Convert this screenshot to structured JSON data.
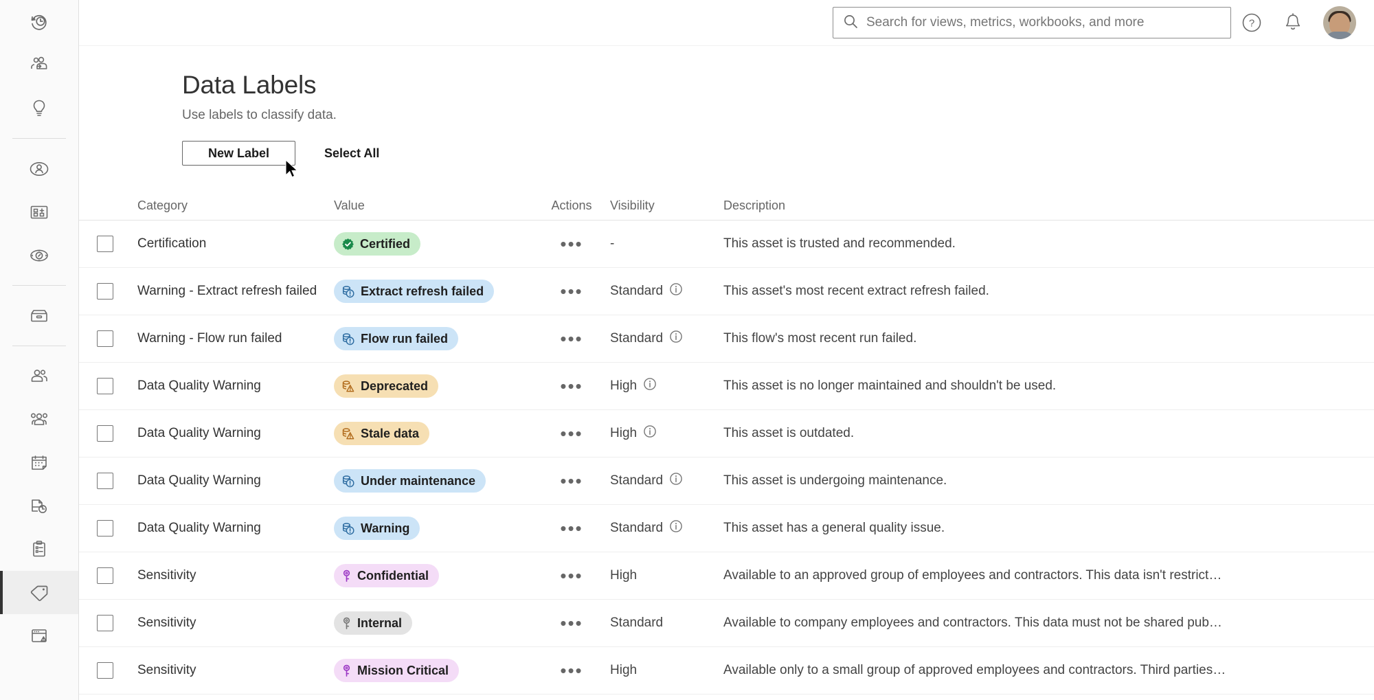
{
  "sidebar": {
    "groups": [
      {
        "items": [
          {
            "name": "recents-icon",
            "label": "Recents"
          },
          {
            "name": "shared-with-me-icon",
            "label": "Shared with Me"
          },
          {
            "name": "recommendations-icon",
            "label": "Recommendations"
          }
        ]
      },
      {
        "items": [
          {
            "name": "personal-space-icon",
            "label": "Personal Space"
          },
          {
            "name": "collections-icon",
            "label": "Collections"
          },
          {
            "name": "explore-icon",
            "label": "Explore"
          }
        ]
      },
      {
        "items": [
          {
            "name": "external-assets-icon",
            "label": "External Assets"
          }
        ]
      },
      {
        "items": [
          {
            "name": "users-icon",
            "label": "Users"
          },
          {
            "name": "groups-icon",
            "label": "Groups"
          },
          {
            "name": "schedules-icon",
            "label": "Schedules"
          },
          {
            "name": "tasks-icon",
            "label": "Tasks"
          },
          {
            "name": "jobs-icon",
            "label": "Jobs"
          },
          {
            "name": "data-labels-icon",
            "label": "Data Labels",
            "active": true
          },
          {
            "name": "site-status-icon",
            "label": "Site Status"
          }
        ]
      }
    ]
  },
  "topbar": {
    "search_placeholder": "Search for views, metrics, workbooks, and more",
    "search_value": "",
    "help_label": "Help",
    "notifications_label": "Notifications",
    "avatar_label": "User account"
  },
  "page": {
    "title": "Data Labels",
    "subtitle": "Use labels to classify data.",
    "new_label_button": "New Label",
    "select_all_button": "Select All"
  },
  "table": {
    "columns": {
      "category": "Category",
      "value": "Value",
      "actions": "Actions",
      "visibility": "Visibility",
      "description": "Description"
    },
    "actions_glyph": "•••",
    "rows": [
      {
        "category": "Certification",
        "value": "Certified",
        "pill_style": "green",
        "pill_icon": "certified-seal-icon",
        "visibility": "-",
        "has_info": false,
        "description": "This asset is trusted and recommended."
      },
      {
        "category": "Warning - Extract refresh failed",
        "value": "Extract refresh failed",
        "pill_style": "blue",
        "pill_icon": "database-alert-icon",
        "visibility": "Standard",
        "has_info": true,
        "description": "This asset's most recent extract refresh failed."
      },
      {
        "category": "Warning - Flow run failed",
        "value": "Flow run failed",
        "pill_style": "blue",
        "pill_icon": "database-alert-icon",
        "visibility": "Standard",
        "has_info": true,
        "description": "This flow's most recent run failed."
      },
      {
        "category": "Data Quality Warning",
        "value": "Deprecated",
        "pill_style": "amber",
        "pill_icon": "database-warning-icon",
        "visibility": "High",
        "has_info": true,
        "description": "This asset is no longer maintained and shouldn't be used."
      },
      {
        "category": "Data Quality Warning",
        "value": "Stale data",
        "pill_style": "amber",
        "pill_icon": "database-warning-icon",
        "visibility": "High",
        "has_info": true,
        "description": "This asset is outdated."
      },
      {
        "category": "Data Quality Warning",
        "value": "Under maintenance",
        "pill_style": "blue",
        "pill_icon": "database-alert-icon",
        "visibility": "Standard",
        "has_info": true,
        "description": "This asset is undergoing maintenance."
      },
      {
        "category": "Data Quality Warning",
        "value": "Warning",
        "pill_style": "blue",
        "pill_icon": "database-alert-icon",
        "visibility": "Standard",
        "has_info": true,
        "description": "This asset has a general quality issue."
      },
      {
        "category": "Sensitivity",
        "value": "Confidential",
        "pill_style": "purple",
        "pill_icon": "key-icon",
        "visibility": "High",
        "has_info": false,
        "description": "Available to an approved group of employees and contractors. This data isn't restrict…"
      },
      {
        "category": "Sensitivity",
        "value": "Internal",
        "pill_style": "gray",
        "pill_icon": "key-icon",
        "visibility": "Standard",
        "has_info": false,
        "description": "Available to company employees and contractors. This data must not be shared pub…"
      },
      {
        "category": "Sensitivity",
        "value": "Mission Critical",
        "pill_style": "purple",
        "pill_icon": "key-icon",
        "visibility": "High",
        "has_info": false,
        "description": "Available only to a small group of approved employees and contractors. Third parties…"
      }
    ]
  },
  "colors": {
    "pill_green": "#c7ecc9",
    "pill_blue": "#cce4f7",
    "pill_amber": "#f6dfb3",
    "pill_purple": "#f4dcf7",
    "pill_gray": "#e3e3e3",
    "certified_icon": "#1a8a4a",
    "blue_icon": "#2c6ba0",
    "amber_icon": "#b06a1a",
    "purple_icon": "#9b37c4",
    "gray_icon": "#767676",
    "sidebar_bg": "#fafafa",
    "active_marker": "#333333"
  }
}
